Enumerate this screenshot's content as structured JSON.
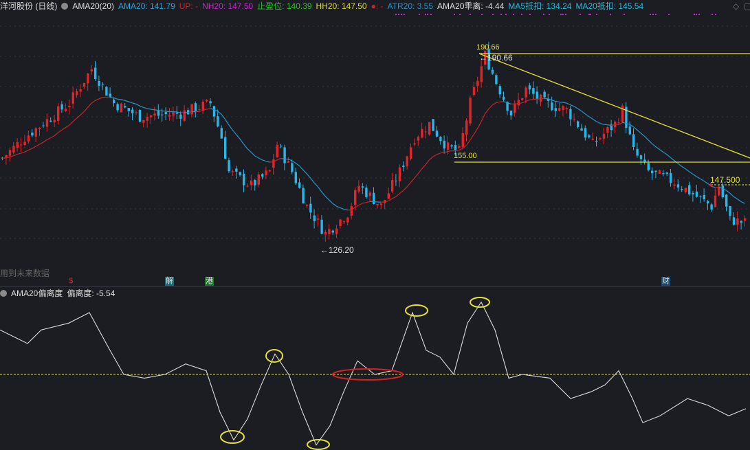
{
  "header": {
    "stock": "洋河股份 (日线)",
    "indicator": "AMA20(20)",
    "ama20": "AMA20: 141.79",
    "up": "UP: -",
    "nh20": "NH20: 147.50",
    "stop": "止盈位: 140.39",
    "hh20": "HH20: 147.50",
    "dot": "●: -",
    "atr20": "ATR20: 3.55",
    "ama20dev": "AMA20乖离: -4.44",
    "ma5": "MA5抵扣: 134.24",
    "ma20": "MA20抵扣: 145.54",
    "diamond_icon": "◇",
    "panel_icon": "▢"
  },
  "main_panel": {
    "high_label_top": "190.66",
    "high_label": "←190.66",
    "low_label": "←126.20",
    "support_label": "155.00",
    "target_label": "147.500",
    "future_note": "用到未来数据",
    "markers": [
      "$",
      "解",
      "港",
      "财"
    ]
  },
  "sub_panel": {
    "title": "AMA20偏离度",
    "value": "偏离度: -5.54"
  },
  "colors": {
    "up": "#e0262a",
    "down": "#29b6e8",
    "ma_up": "#c8242a",
    "ma_down": "#2a95c9",
    "yellow": "#e6e233",
    "bg": "#1b1d22"
  },
  "price_path": [
    [
      0,
      155.3
    ],
    [
      6,
      162.3
    ],
    [
      18,
      173.9
    ],
    [
      24,
      185.5
    ],
    [
      30,
      173.9
    ],
    [
      37,
      169.3
    ],
    [
      48,
      170.4
    ],
    [
      56,
      173.9
    ],
    [
      59,
      162.3
    ],
    [
      61,
      150.7
    ],
    [
      67,
      146.0
    ],
    [
      72,
      150.7
    ],
    [
      74,
      160.0
    ],
    [
      78,
      150.7
    ],
    [
      82,
      139.0
    ],
    [
      87,
      129.7
    ],
    [
      93,
      136.7
    ],
    [
      96,
      146.0
    ],
    [
      102,
      139.0
    ],
    [
      107,
      150.7
    ],
    [
      111,
      162.3
    ],
    [
      115,
      166.9
    ],
    [
      120,
      158.8
    ],
    [
      123,
      157.6
    ],
    [
      126,
      173.9
    ],
    [
      130,
      190.2
    ],
    [
      133,
      180.9
    ],
    [
      137,
      170.4
    ],
    [
      141,
      178.6
    ],
    [
      146,
      173.9
    ],
    [
      152,
      171.6
    ],
    [
      159,
      160.0
    ],
    [
      165,
      166.9
    ],
    [
      167,
      171.6
    ],
    [
      170,
      157.6
    ],
    [
      174,
      150.7
    ],
    [
      181,
      147.2
    ],
    [
      191,
      139.0
    ],
    [
      193,
      146.0
    ],
    [
      196,
      134.4
    ],
    [
      201,
      133.2
    ]
  ],
  "deviation_path": [
    [
      0,
      7.2
    ],
    [
      20,
      6.1
    ],
    [
      40,
      5.0
    ],
    [
      60,
      7.2
    ],
    [
      100,
      8.3
    ],
    [
      130,
      10.0
    ],
    [
      160,
      3.9
    ],
    [
      180,
      0
    ],
    [
      210,
      -0.6
    ],
    [
      240,
      0
    ],
    [
      270,
      1.7
    ],
    [
      300,
      0.6
    ],
    [
      320,
      -6.1
    ],
    [
      340,
      -10.6
    ],
    [
      360,
      -7.2
    ],
    [
      380,
      -1.7
    ],
    [
      400,
      3.3
    ],
    [
      420,
      0
    ],
    [
      440,
      -6.1
    ],
    [
      460,
      -11.4
    ],
    [
      480,
      -8.3
    ],
    [
      500,
      -2.8
    ],
    [
      520,
      2.2
    ],
    [
      545,
      0
    ],
    [
      570,
      0.6
    ],
    [
      600,
      10.0
    ],
    [
      620,
      3.9
    ],
    [
      640,
      2.8
    ],
    [
      660,
      0
    ],
    [
      680,
      8.3
    ],
    [
      700,
      11.7
    ],
    [
      720,
      7.2
    ],
    [
      740,
      -0.6
    ],
    [
      760,
      0
    ],
    [
      800,
      -0.6
    ],
    [
      830,
      -3.9
    ],
    [
      860,
      -2.8
    ],
    [
      880,
      -1.7
    ],
    [
      900,
      0.6
    ],
    [
      920,
      -3.9
    ],
    [
      935,
      -7.8
    ],
    [
      960,
      -6.7
    ],
    [
      1000,
      -3.9
    ],
    [
      1030,
      -5.0
    ],
    [
      1060,
      -6.7
    ],
    [
      1085,
      -5.54
    ]
  ]
}
